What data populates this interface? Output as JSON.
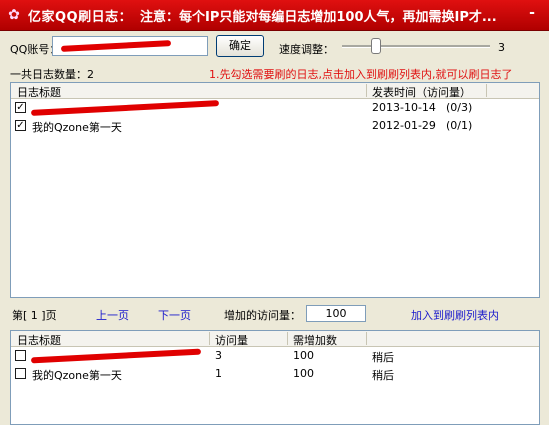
{
  "titlebar": {
    "app_title": "亿家QQ刷日志：",
    "notice": "注意：每个IP只能对每编日志增加100人气，再加需换IP才...",
    "dash": "-",
    "app_icon": "flower-icon"
  },
  "login": {
    "qq_label": "QQ账号：",
    "confirm_button": "确定",
    "speed_label": "速度调整：",
    "speed_value": "3",
    "speed_level": 0.25
  },
  "summary": {
    "total_label": "一共日志数量：2",
    "hint": "1.先勾选需要刷的日志,点击加入到刷刷列表内,就可以刷日志了"
  },
  "log_list": {
    "columns": [
      "日志标题",
      "发表时间（访问量）"
    ],
    "rows": [
      {
        "title": "",
        "checked": true,
        "date": "2013-10-14",
        "views": "(0/3)"
      },
      {
        "title": "我的Qzone第一天",
        "checked": true,
        "date": "2012-01-29",
        "views": "(0/1)"
      }
    ]
  },
  "pager": {
    "page_label": "第[ 1 ]页",
    "prev": "上一页",
    "next": "下一页",
    "increase_label": "增加的访问量：",
    "increase_value": "100",
    "add_to_list": "加入到刷刷列表内"
  },
  "brush_list": {
    "columns": [
      "日志标题",
      "访问量",
      "需增加数"
    ],
    "rows": [
      {
        "title": "",
        "checked": false,
        "visits": "3",
        "needed": "100",
        "status": "稍后"
      },
      {
        "title": "我的Qzone第一天",
        "checked": false,
        "visits": "1",
        "needed": "100",
        "status": "稍后"
      }
    ]
  }
}
